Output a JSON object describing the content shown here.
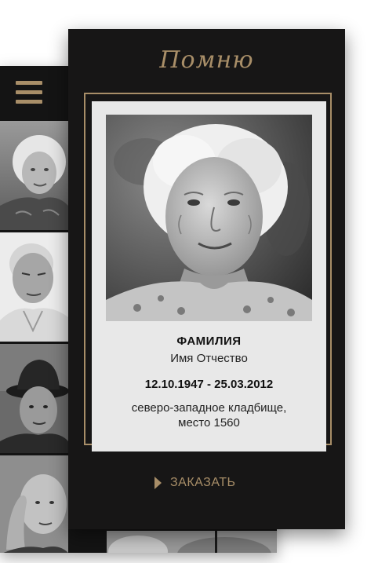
{
  "brand": {
    "logo_text": "Помню"
  },
  "menu": {
    "icon": "hamburger-menu-icon",
    "accent": "#a88e68"
  },
  "gallery": {
    "items": [
      {
        "name": "elderly-woman-photo"
      },
      {
        "name": "elderly-man-photo"
      },
      {
        "name": "man-in-hat-photo"
      },
      {
        "name": "elderly-man-hand-photo"
      }
    ]
  },
  "card": {
    "surname": "ФАМИЛИЯ",
    "given_names": "Имя Отчество",
    "dates": "12.10.1947 - 25.03.2012",
    "place_line1": "северо-западное кладбище,",
    "place_line2": "место 1560"
  },
  "actions": {
    "order_label": "ЗАКАЗАТЬ",
    "order_icon": "play-triangle-icon"
  },
  "colors": {
    "accent": "#a88e68",
    "panel": "#171616",
    "card": "#e8e8e8"
  }
}
